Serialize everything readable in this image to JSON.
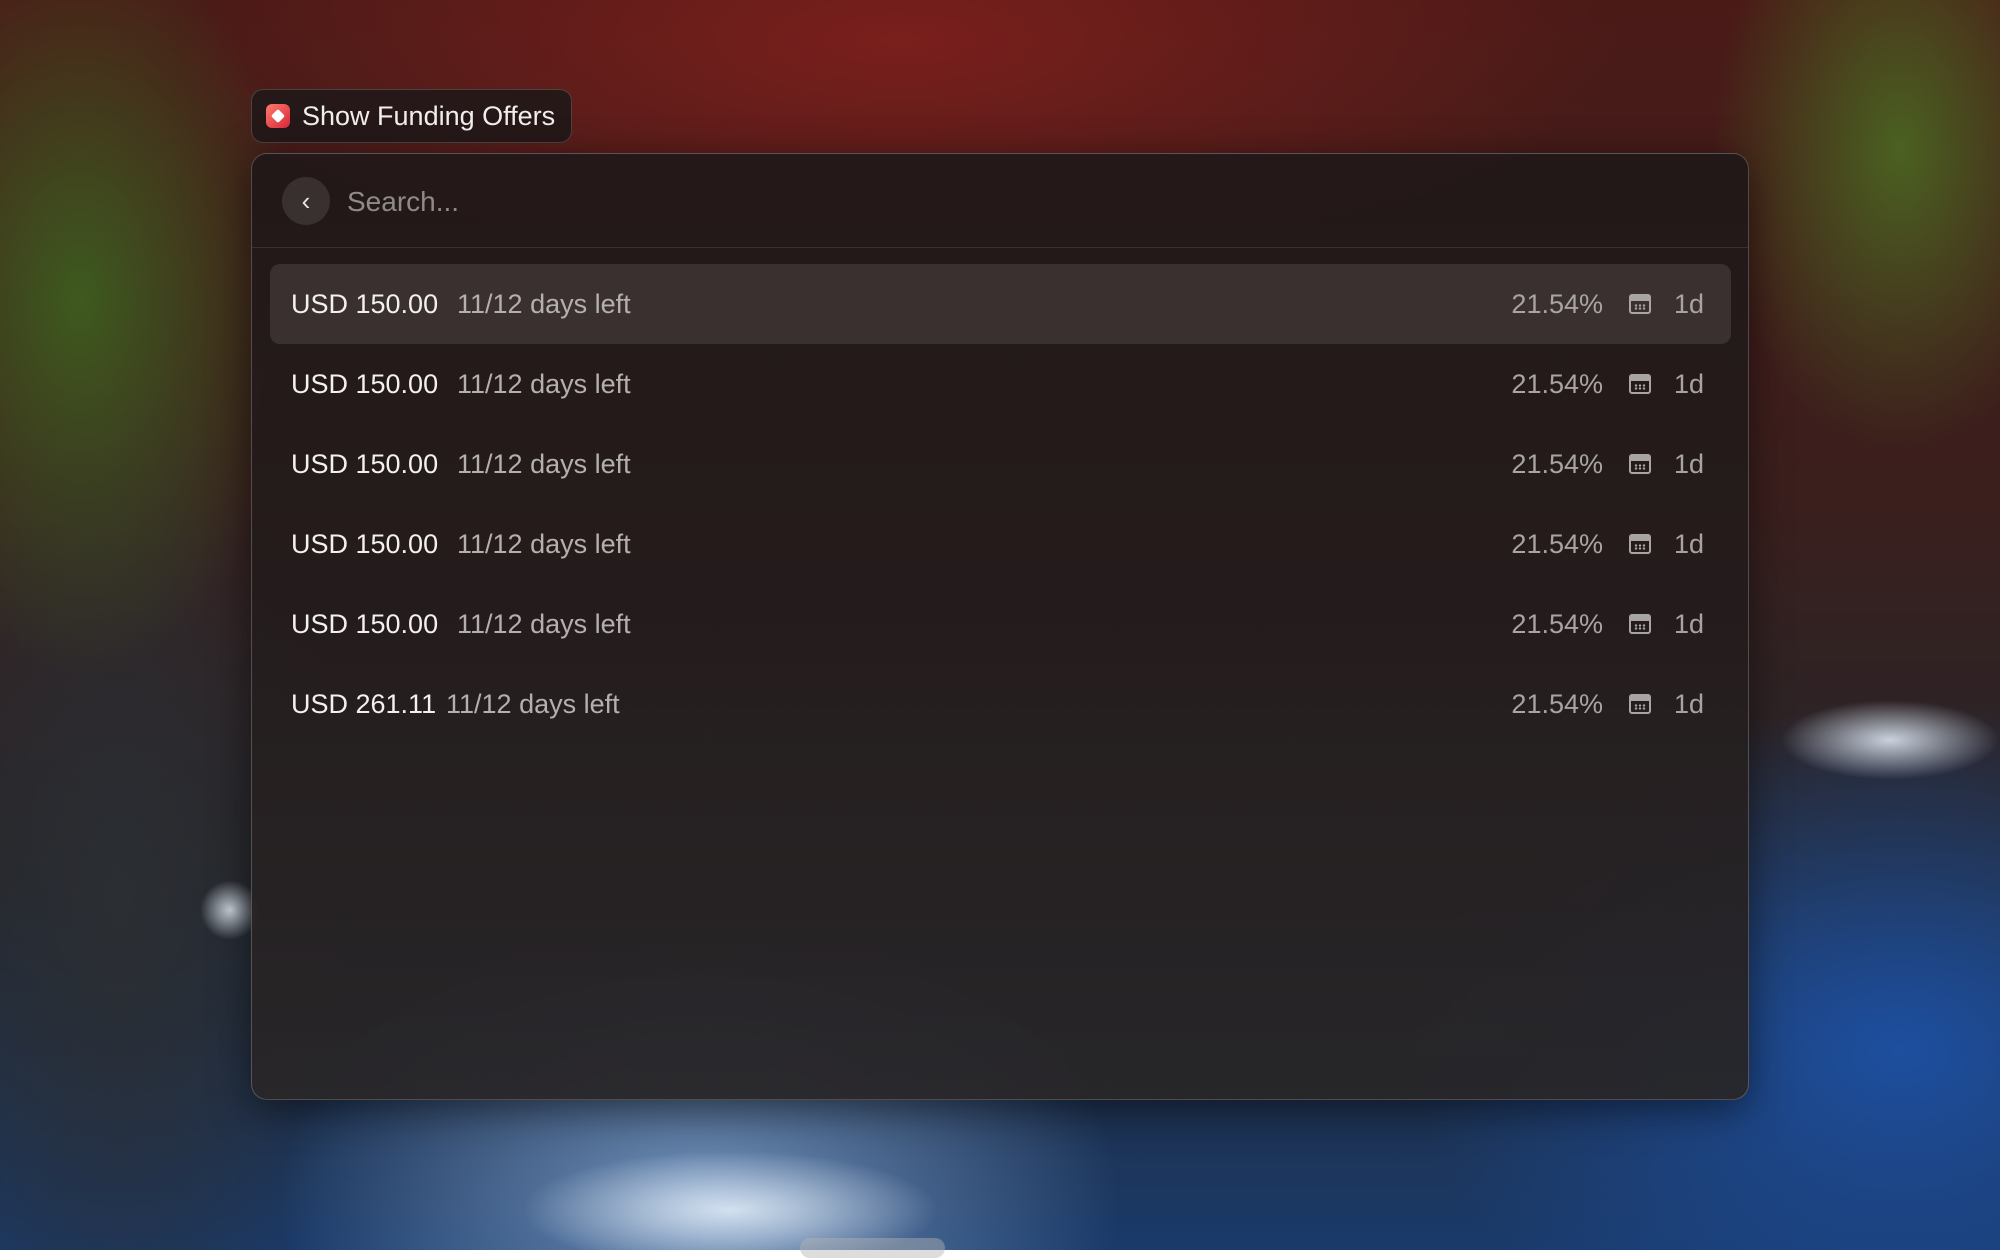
{
  "title_chip": {
    "label": "Show Funding Offers",
    "icon": "app-logo-icon",
    "icon_color": "#e23a45"
  },
  "search": {
    "placeholder": "Search...",
    "value": ""
  },
  "back_icon": "‹",
  "rows": [
    {
      "amount": "USD 150.00",
      "subtitle": "11/12 days left",
      "rate": "21.54%",
      "duration": "1d",
      "selected": true
    },
    {
      "amount": "USD 150.00",
      "subtitle": "11/12 days left",
      "rate": "21.54%",
      "duration": "1d",
      "selected": false
    },
    {
      "amount": "USD 150.00",
      "subtitle": "11/12 days left",
      "rate": "21.54%",
      "duration": "1d",
      "selected": false
    },
    {
      "amount": "USD 150.00",
      "subtitle": "11/12 days left",
      "rate": "21.54%",
      "duration": "1d",
      "selected": false
    },
    {
      "amount": "USD 150.00",
      "subtitle": "11/12 days left",
      "rate": "21.54%",
      "duration": "1d",
      "selected": false
    },
    {
      "amount": "USD 261.11",
      "subtitle": "11/12 days left",
      "rate": "21.54%",
      "duration": "1d",
      "selected": false
    }
  ]
}
